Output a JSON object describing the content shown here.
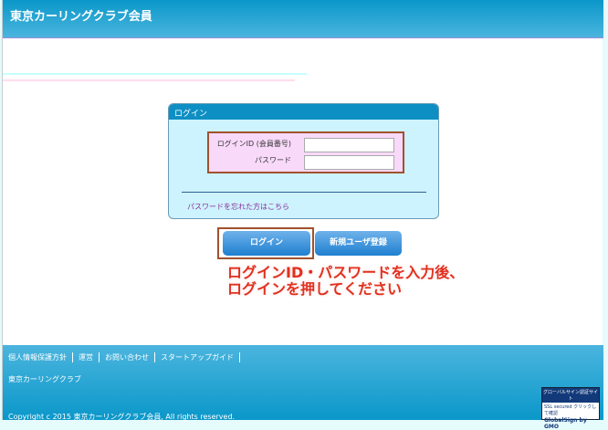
{
  "header": {
    "title": "東京カーリングクラブ会員"
  },
  "login": {
    "panel_title": "ログイン",
    "id_label": "ログインID (会員番号)",
    "password_label": "パスワード",
    "id_value": "",
    "password_value": "",
    "forgot_link": "パスワードを忘れた方はこちら",
    "login_button": "ログイン",
    "register_button": "新規ユーザ登録"
  },
  "annotation": {
    "line1": "ログインID・パスワードを入力後、",
    "line2": "ログインを押してください"
  },
  "footer": {
    "links": [
      "個人情報保護方針",
      "運営",
      "お問い合わせ",
      "スタートアップガイド"
    ],
    "club": "東京カーリングクラブ",
    "copyright": "Copyright c 2015 東京カーリングクラブ会員, All rights reserved.",
    "badge": {
      "title": "グローバルサイン認証サイト",
      "ssl": "SSL secured クリックして確認",
      "brand": "GlobalSign by GMO"
    }
  }
}
